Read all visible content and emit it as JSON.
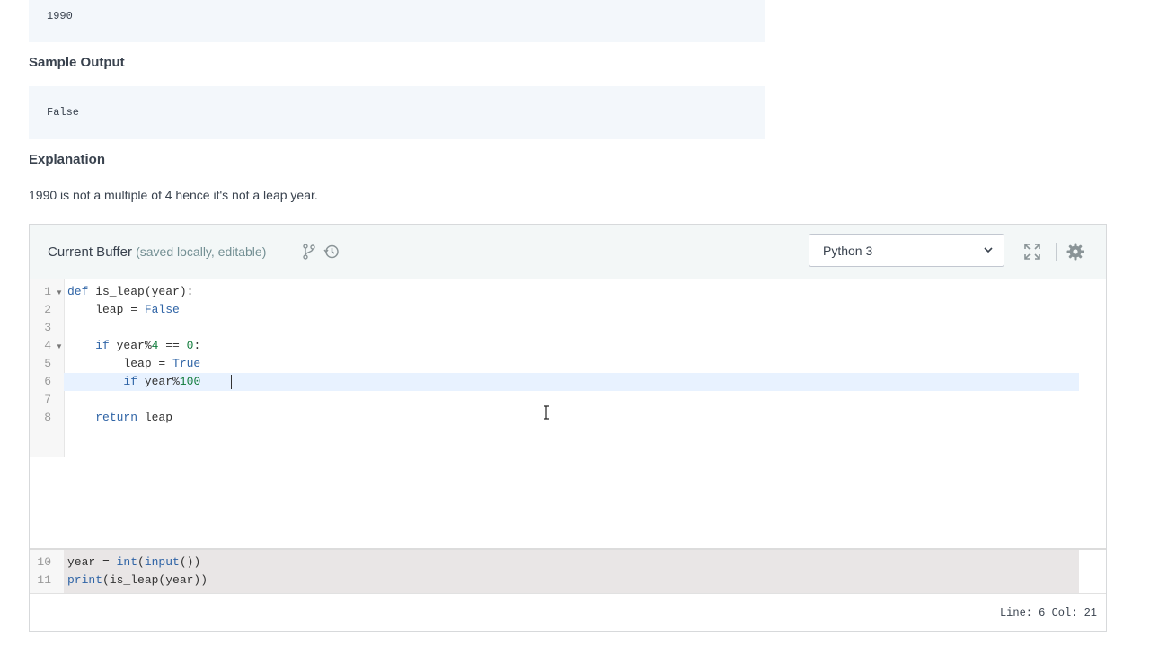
{
  "problem": {
    "sample_input_value": "1990",
    "sample_output_heading": "Sample Output",
    "sample_output_value": "False",
    "explanation_heading": "Explanation",
    "explanation_text": "1990 is not a multiple of 4 hence it's not a leap year."
  },
  "editor": {
    "title": "Current Buffer",
    "subtitle": "(saved locally, editable)",
    "language": "Python 3",
    "line_numbers": [
      "1",
      "2",
      "3",
      "4",
      "5",
      "6",
      "7",
      "8"
    ],
    "code": {
      "l1_kw": "def",
      "l1_rest": " is_leap(year):",
      "l2_a": "    leap = ",
      "l2_bool": "False",
      "l4_kw": "if",
      "l4_a": " year%",
      "l4_num1": "4",
      "l4_b": " == ",
      "l4_num2": "0",
      "l4_c": ":",
      "l5_a": "        leap = ",
      "l5_bool": "True",
      "l6_kw": "if",
      "l6_a": " year%",
      "l6_num": "100",
      "l8_kw": "return",
      "l8_rest": " leap"
    },
    "tail_line_numbers": [
      "10",
      "11"
    ],
    "tail_code": {
      "l10_a": "year = ",
      "l10_b": "int",
      "l10_c": "(",
      "l10_d": "input",
      "l10_e": "())",
      "l11_a": "print",
      "l11_b": "(is_leap(year))"
    },
    "status": "Line: 6 Col: 21"
  },
  "colors": {
    "keyword": "#2f64a6",
    "number": "#0f7b3b",
    "active_line": "#e8f2ff",
    "code_box_bg": "#f3f7fb"
  },
  "icons": [
    "branch-icon",
    "history-icon",
    "chevron-down-icon",
    "fullscreen-icon",
    "gear-icon",
    "text-cursor-icon"
  ]
}
